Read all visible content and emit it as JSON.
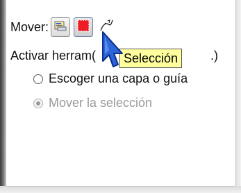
{
  "mover": {
    "label": "Mover:",
    "tools": [
      {
        "icon": "move-layer-icon",
        "active": false
      },
      {
        "icon": "move-selection-icon",
        "active": true
      },
      {
        "icon": "move-path-icon",
        "active": false
      }
    ]
  },
  "activar": {
    "text_visible": "Activar herram",
    "text_tail": "(",
    "text_tail2": ".)"
  },
  "tooltip": {
    "text": "Selección"
  },
  "options": [
    {
      "label": "Escoger una capa o guía",
      "checked": false,
      "disabled": false
    },
    {
      "label": "Mover la selección",
      "checked": true,
      "disabled": true
    }
  ],
  "colors": {
    "accent_red": "#ee1c24",
    "tooltip_bg": "#ffff9e",
    "cursor_blue": "#2d64d8"
  }
}
